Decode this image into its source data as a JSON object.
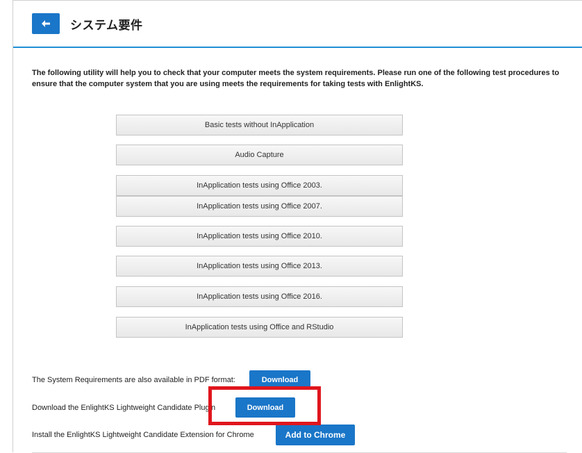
{
  "header": {
    "title": "システム要件",
    "back_icon": "arrow-left-icon",
    "accent_color": "#1f8fd6"
  },
  "intro_text": "The following utility will help you to check that your computer meets the system requirements. Please run one of the following test procedures to ensure that the computer system that you are using meets the requirements for taking tests with EnlightKS.",
  "tests": {
    "basic": "Basic tests without InApplication",
    "audio": "Audio Capture",
    "office2003": "InApplication tests using Office 2003.",
    "office2007": "InApplication tests using Office 2007.",
    "office2010": "InApplication tests using Office 2010.",
    "office2013": "InApplication tests using Office 2013.",
    "office2016": "InApplication tests using Office 2016.",
    "office_rstudio": "InApplication tests using Office and RStudio"
  },
  "downloads": {
    "pdf_text": "The System Requirements are also available in PDF format:",
    "pdf_button": "Download",
    "plugin_text": "Download the EnlightKS Lightweight Candidate Plugin",
    "plugin_button": "Download",
    "chrome_text": "Install the EnlightKS Lightweight Candidate Extension for Chrome",
    "chrome_button": "Add to Chrome",
    "button_color": "#1a76c8",
    "highlight_color": "#e0161d"
  }
}
